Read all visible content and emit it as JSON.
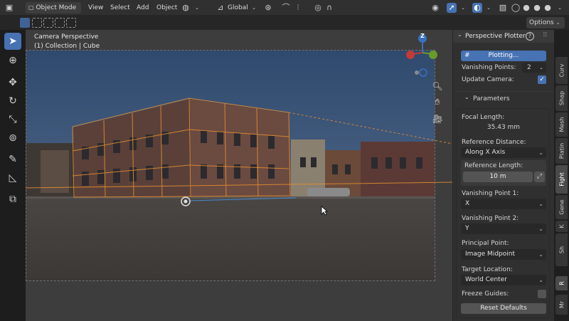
{
  "header": {
    "mode": "Object Mode",
    "menus": [
      "View",
      "Select",
      "Add",
      "Object"
    ],
    "transform_orientation": "Global",
    "options_label": "Options"
  },
  "viewport": {
    "title_line1": "Camera Perspective",
    "title_line2": "(1) Collection | Cube",
    "gizmo_axis_label": "Z"
  },
  "panel": {
    "title": "Perspective Plotter",
    "help_glyph": "?",
    "plot_button": "Plotting...",
    "vanishing_points_label": "Vanishing Points:",
    "vanishing_points_value": "2",
    "update_camera_label": "Update Camera:",
    "update_camera_checked": true,
    "parameters_label": "Parameters",
    "focal_length_label": "Focal Length:",
    "focal_length_value": "35.43 mm",
    "reference_distance_label": "Reference Distance:",
    "reference_distance_value": "Along X Axis",
    "reference_length_label": "Reference Length:",
    "reference_length_value": "10 m",
    "vp1_label": "Vanishing Point 1:",
    "vp1_value": "X",
    "vp2_label": "Vanishing Point 2:",
    "vp2_value": "Y",
    "principal_point_label": "Principal Point:",
    "principal_point_value": "Image Midpoint",
    "target_location_label": "Target Location:",
    "target_location_value": "World Center",
    "freeze_guides_label": "Freeze Guides:",
    "freeze_guides_checked": false,
    "reset_button": "Reset Defaults"
  },
  "tabs": [
    "Curv",
    "Shap",
    "Mesh",
    "Platin",
    "Fight",
    "Gene",
    "K",
    "Sh",
    "R",
    "Mr"
  ],
  "colors": {
    "accent": "#4772b3",
    "guide_orange": "#e8902e",
    "gizmo_x": "#c23a3a",
    "gizmo_y": "#6a9a2a",
    "gizmo_z": "#3a6fc2"
  }
}
